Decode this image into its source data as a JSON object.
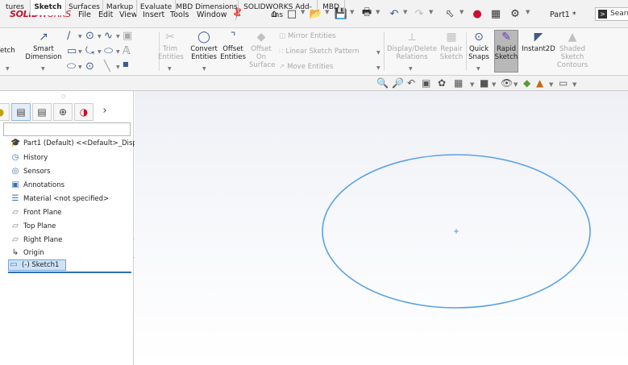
{
  "app": {
    "logo_bold": "SOLID",
    "logo_rest": "WORKS",
    "menus": [
      "File",
      "Edit",
      "View",
      "Insert",
      "Tools",
      "Window"
    ],
    "document_title": "Part1 *",
    "search_text": "Searc"
  },
  "ribbon": {
    "sketch": "etch",
    "smart_dimension_line1": "Smart",
    "smart_dimension_line2": "Dimension",
    "trim_line1": "Trim",
    "trim_line2": "Entities",
    "convert_line1": "Convert",
    "convert_line2": "Entities",
    "offset_line1": "Offset",
    "offset_line2": "Entities",
    "offset_surface_line1": "Offset",
    "offset_surface_line2": "On",
    "offset_surface_line3": "Surface",
    "mirror": "Mirror Entities",
    "linear_pattern": "Linear Sketch Pattern",
    "move": "Move Entities",
    "display_delete_line1": "Display/Delete",
    "display_delete_line2": "Relations",
    "repair_line1": "Repair",
    "repair_line2": "Sketch",
    "quick_snaps_line1": "Quick",
    "quick_snaps_line2": "Snaps",
    "rapid_line1": "Rapid",
    "rapid_line2": "Sketch",
    "instant2d": "Instant2D",
    "shaded_line1": "Shaded",
    "shaded_line2": "Sketch",
    "shaded_line3": "Contours"
  },
  "tabs": [
    "tures",
    "Sketch",
    "Surfaces",
    "Markup",
    "Evaluate",
    "MBD Dimensions",
    "SOLIDWORKS Add-Ins",
    "MBD"
  ],
  "active_tab": "Sketch",
  "tree": {
    "items": [
      {
        "label": "Part1 (Default) <<Default>_Displa",
        "icon": "part-icon"
      },
      {
        "label": "History",
        "icon": "history-icon"
      },
      {
        "label": "Sensors",
        "icon": "sensors-icon"
      },
      {
        "label": "Annotations",
        "icon": "annotations-icon"
      },
      {
        "label": "Material <not specified>",
        "icon": "material-icon"
      },
      {
        "label": "Front Plane",
        "icon": "plane-icon"
      },
      {
        "label": "Top Plane",
        "icon": "plane-icon"
      },
      {
        "label": "Right Plane",
        "icon": "plane-icon"
      },
      {
        "label": "Origin",
        "icon": "origin-icon"
      },
      {
        "label": "(-) Sketch1",
        "icon": "sketch-icon"
      }
    ]
  },
  "colors": {
    "accent": "#c8102e",
    "selection": "#cfe3f7",
    "ellipse": "#5aa2e6",
    "rapid_bg": "#b8b8b8"
  }
}
